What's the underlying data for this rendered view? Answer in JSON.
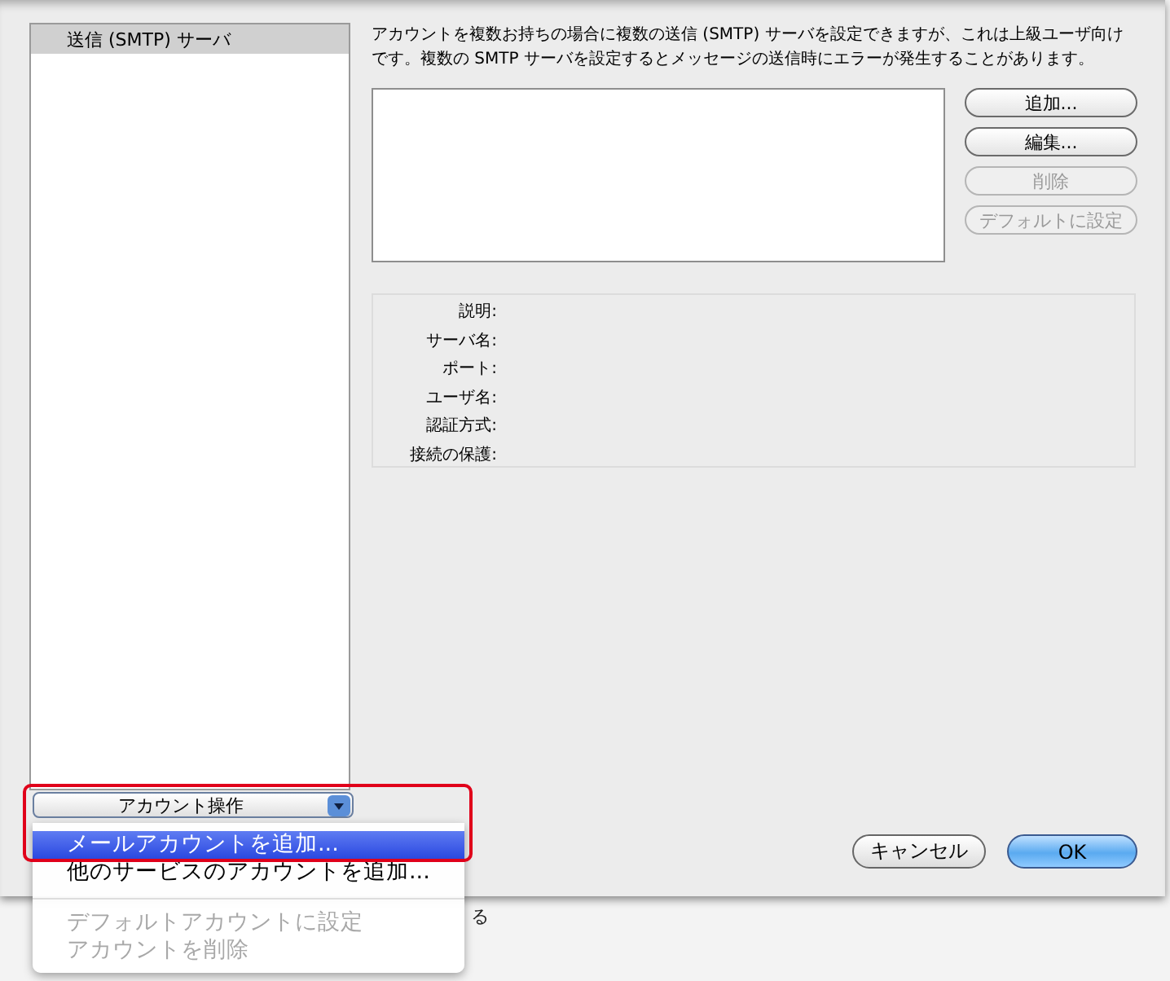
{
  "sidebar": {
    "items": [
      {
        "label": "送信 (SMTP) サーバ",
        "selected": true
      }
    ]
  },
  "description": "アカウントを複数お持ちの場合に複数の送信 (SMTP) サーバを設定できますが、これは上級ユーザ向けです。複数の SMTP サーバを設定するとメッセージの送信時にエラーが発生することがあります。",
  "side_buttons": [
    {
      "label": "追加...",
      "disabled": false
    },
    {
      "label": "編集...",
      "disabled": false
    },
    {
      "label": "削除",
      "disabled": true
    },
    {
      "label": "デフォルトに設定",
      "disabled": true
    }
  ],
  "details": [
    "説明:",
    "サーバ名:",
    "ポート:",
    "ユーザ名:",
    "認証方式:",
    "接続の保護:"
  ],
  "action_popup": {
    "label": "アカウント操作"
  },
  "menu": {
    "items": [
      {
        "kind": "item",
        "label": "メールアカウントを追加...",
        "selected": true,
        "disabled": false
      },
      {
        "kind": "item",
        "label": "他のサービスのアカウントを追加...",
        "selected": false,
        "disabled": false
      },
      {
        "kind": "separator"
      },
      {
        "kind": "item",
        "label": "デフォルトアカウントに設定",
        "selected": false,
        "disabled": true
      },
      {
        "kind": "item",
        "label": "アカウントを削除",
        "selected": false,
        "disabled": true
      }
    ]
  },
  "background_text": "る",
  "buttons": [
    {
      "label": "キャンセル",
      "default": false
    },
    {
      "label": "OK",
      "default": true
    }
  ]
}
